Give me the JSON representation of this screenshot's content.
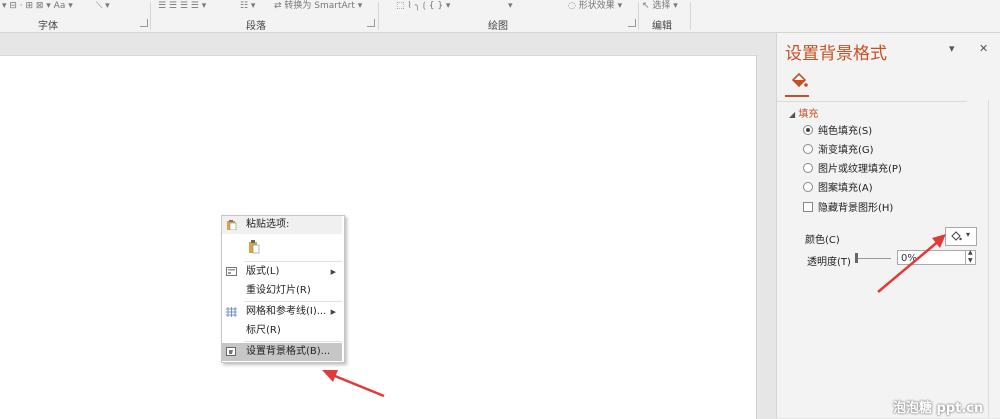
{
  "ribbon": {
    "groups": [
      "字体",
      "段落",
      "绘图",
      "编辑"
    ],
    "smartart_label": "转换为 SmartArt",
    "shape_effects_label": "形状效果",
    "select_label": "选择"
  },
  "context_menu": {
    "paste_options_label": "粘贴选项:",
    "items": [
      {
        "label": "版式(L)",
        "submenu": true
      },
      {
        "label": "重设幻灯片(R)",
        "submenu": false
      },
      {
        "label": "网格和参考线(I)...",
        "submenu": true
      },
      {
        "label": "标尺(R)",
        "submenu": false
      },
      {
        "label": "设置背景格式(B)...",
        "submenu": false
      }
    ]
  },
  "format_pane": {
    "title": "设置背景格式",
    "section": "填充",
    "options": [
      {
        "label": "纯色填充(S)",
        "selected": true
      },
      {
        "label": "渐变填充(G)",
        "selected": false
      },
      {
        "label": "图片或纹理填充(P)",
        "selected": false
      },
      {
        "label": "图案填充(A)",
        "selected": false
      }
    ],
    "hide_graphics_label": "隐藏背景图形(H)",
    "color_label": "颜色(C)",
    "transparency_label": "透明度(T)",
    "transparency_value": "0%"
  },
  "watermark": "泡泡糖 ppt.cn",
  "colors": {
    "accent": "#c94f23",
    "arrow": "#e03a3a"
  }
}
